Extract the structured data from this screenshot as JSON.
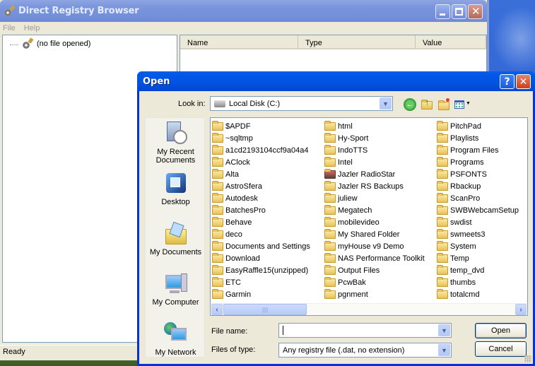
{
  "main_window": {
    "title": "Direct Registry Browser",
    "menu": [
      "File",
      "Help"
    ],
    "tree_root": "(no file opened)",
    "columns": [
      "Name",
      "Type",
      "Value"
    ],
    "status": "Ready",
    "buttons": {
      "minimize": "minimize",
      "maximize": "maximize",
      "close": "close"
    }
  },
  "dialog": {
    "title": "Open",
    "help_glyph": "?",
    "close_glyph": "✕",
    "look_in_label": "Look in:",
    "look_in_value": "Local Disk (C:)",
    "toolbar": [
      "back-icon",
      "up-folder-icon",
      "new-folder-icon",
      "views-menu-icon"
    ],
    "places": [
      {
        "label": "My Recent Documents",
        "icon": "recent-documents-icon"
      },
      {
        "label": "Desktop",
        "icon": "desktop-icon"
      },
      {
        "label": "My Documents",
        "icon": "my-documents-icon"
      },
      {
        "label": "My Computer",
        "icon": "my-computer-icon"
      },
      {
        "label": "My Network",
        "icon": "my-network-icon"
      }
    ],
    "files": {
      "col1": [
        "$APDF",
        "~sqltmp",
        "a1cd2193104ccf9a04a4",
        "AClock",
        "Alta",
        "AstroSfera",
        "Autodesk",
        "BatchesPro",
        "Behave",
        "deco",
        "Documents and Settings",
        "Download",
        "EasyRaffle15(unzipped)",
        "ETC",
        "Garmin"
      ],
      "col2": [
        "html",
        "Hy-Sport",
        "IndoTTS",
        "Intel",
        "Jazler RadioStar",
        "Jazler RS Backups",
        "juliew",
        "Megatech",
        "mobilevideo",
        "My Shared Folder",
        "myHouse v9 Demo",
        "NAS Performance Toolkit",
        "Output Files",
        "PcwBak",
        "pgnment"
      ],
      "col3": [
        "PitchPad",
        "Playlists",
        "Program Files",
        "Programs",
        "PSFONTS",
        "Rbackup",
        "ScanPro",
        "SWBWebcamSetup",
        "swdist",
        "swmeets3",
        "System",
        "Temp",
        "temp_dvd",
        "thumbs",
        "totalcmd"
      ]
    },
    "file_name_label": "File name:",
    "file_name_value": "",
    "file_type_label": "Files of type:",
    "file_type_value": "Any registry file (.dat, no extension)",
    "open_label": "Open",
    "cancel_label": "Cancel"
  }
}
